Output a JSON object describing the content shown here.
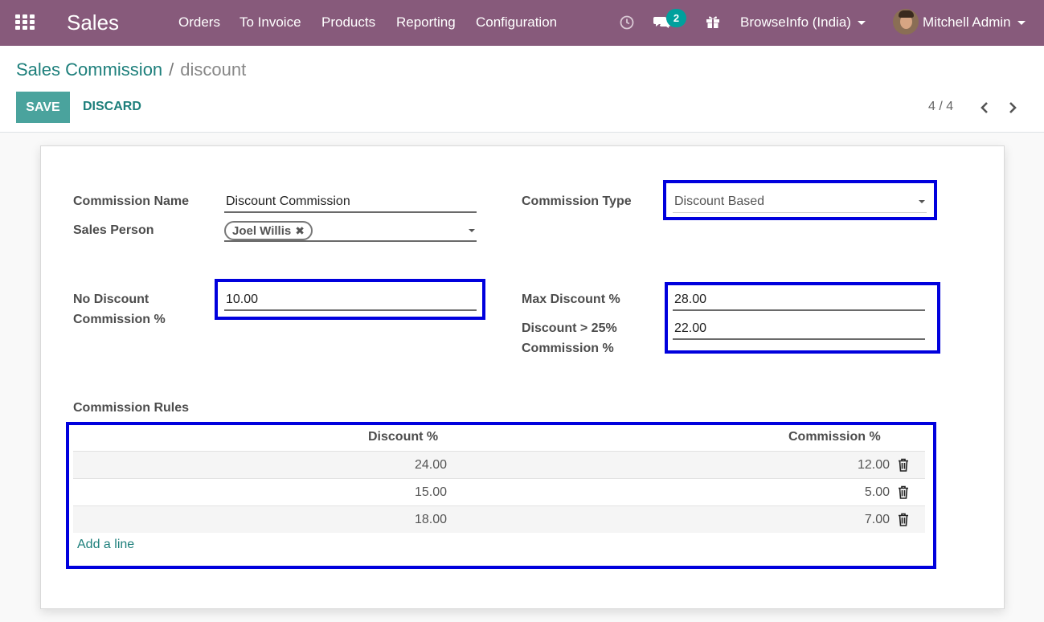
{
  "navbar": {
    "app_name": "Sales",
    "menus": [
      "Orders",
      "To Invoice",
      "Products",
      "Reporting",
      "Configuration"
    ],
    "messages_count": "2",
    "company": "BrowseInfo (India)",
    "user": "Mitchell Admin",
    "icons": [
      "apps-grid-icon",
      "clock-icon",
      "chat-icon",
      "gift-icon"
    ]
  },
  "control_panel": {
    "breadcrumb_parent": "Sales Commission",
    "breadcrumb_separator": "/",
    "breadcrumb_current": "discount",
    "save_label": "SAVE",
    "discard_label": "DISCARD",
    "pager": "4 / 4"
  },
  "form": {
    "commission_name_label": "Commission Name",
    "commission_name_value": "Discount Commission",
    "sales_person_label": "Sales Person",
    "sales_person_tag": "Joel Willis",
    "commission_type_label": "Commission Type",
    "commission_type_value": "Discount Based",
    "no_discount_label_1": "No Discount",
    "no_discount_label_2": "Commission %",
    "no_discount_value": "10.00",
    "max_discount_label": "Max Discount %",
    "max_discount_value": "28.00",
    "discount_gt_label_1": "Discount > 25%",
    "discount_gt_label_2": "Commission %",
    "discount_gt_value": "22.00",
    "rules_label": "Commission Rules",
    "rules_columns": [
      "Discount %",
      "Commission %"
    ],
    "rules_rows": [
      {
        "discount": "24.00",
        "commission": "12.00"
      },
      {
        "discount": "15.00",
        "commission": "5.00"
      },
      {
        "discount": "18.00",
        "commission": "7.00"
      }
    ],
    "add_line_label": "Add a line"
  },
  "colors": {
    "navbar": "#875a7b",
    "primary": "#4aa39d",
    "link": "#1d7f7b",
    "highlight": "#0000dd",
    "badge": "#00a09d"
  }
}
